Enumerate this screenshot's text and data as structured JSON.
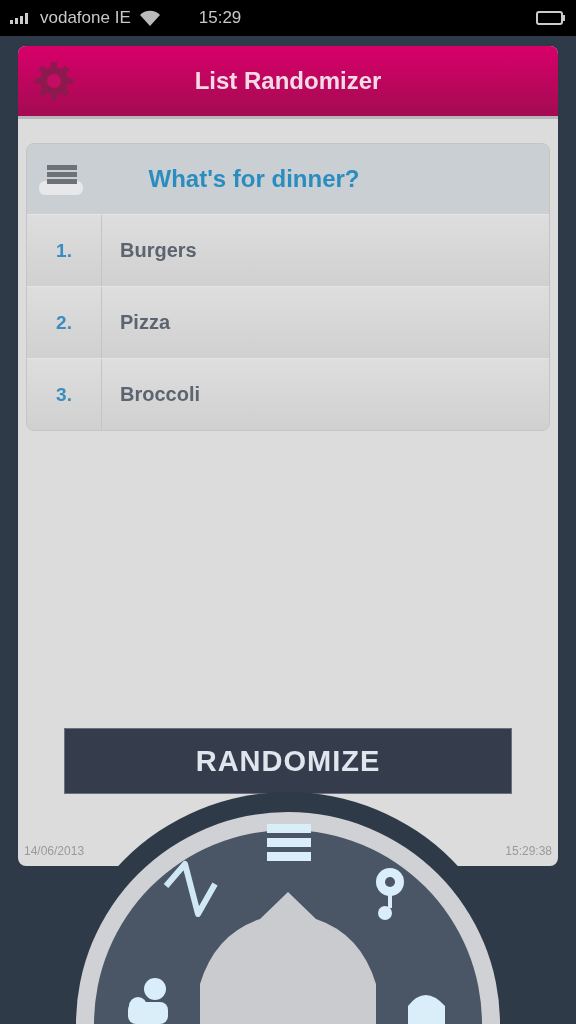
{
  "status_bar": {
    "carrier": "vodafone IE",
    "time": "15:29"
  },
  "header": {
    "title": "List Randomizer"
  },
  "list": {
    "title": "What's for dinner?",
    "items": [
      {
        "number": "1.",
        "label": "Burgers"
      },
      {
        "number": "2.",
        "label": "Pizza"
      },
      {
        "number": "3.",
        "label": "Broccoli"
      }
    ]
  },
  "button": "RANDOMIZE",
  "footer": {
    "date": "14/06/2013",
    "time": "15:29:38"
  }
}
